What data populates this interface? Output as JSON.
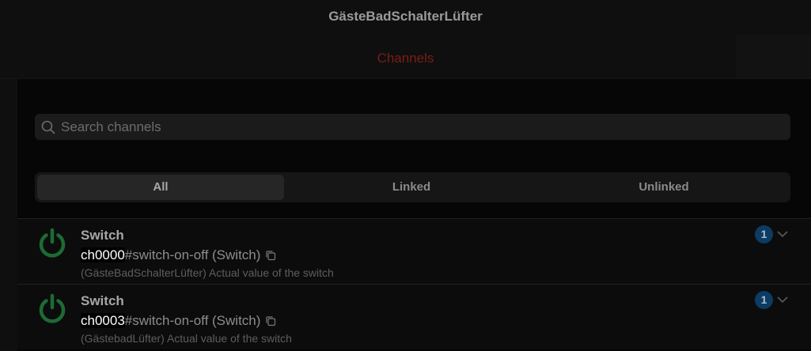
{
  "header": {
    "title": "GästeBadSchalterLüfter",
    "active_tab": "Channels"
  },
  "search": {
    "placeholder": "Search channels",
    "value": ""
  },
  "filter": {
    "options": [
      "All",
      "Linked",
      "Unlinked"
    ],
    "selected": "All"
  },
  "channels": [
    {
      "label": "Switch",
      "channel_id": "ch0000",
      "type_suffix": "#switch-on-off (Switch)",
      "description": "(GästeBadSchalterLüfter) Actual value of the switch",
      "link_count": "1"
    },
    {
      "label": "Switch",
      "channel_id": "ch0003",
      "type_suffix": "#switch-on-off (Switch)",
      "description": "(GästebadLüfter) Actual value of the switch",
      "link_count": "1"
    }
  ],
  "icons": {
    "search": "search-icon",
    "power": "power-icon",
    "copy": "copy-icon",
    "expand": "chevron-down-icon"
  },
  "colors": {
    "accent_tab": "#7a1d17",
    "power_icon": "#1d6b34",
    "badge": "#0d3b61"
  }
}
